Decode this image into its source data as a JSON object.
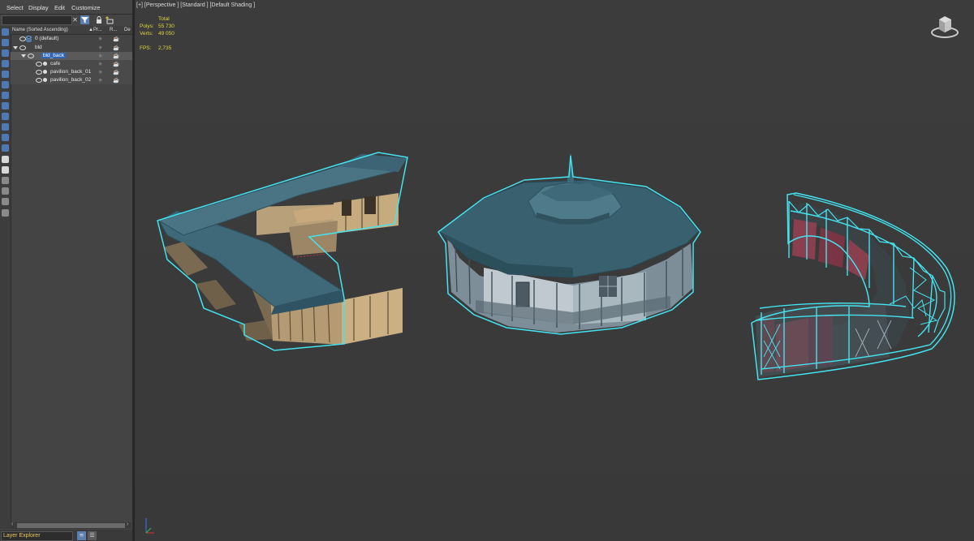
{
  "menu": {
    "select": "Select",
    "display": "Display",
    "edit": "Edit",
    "customize": "Customize"
  },
  "search": {
    "value": "",
    "placeholder": ""
  },
  "icons": {
    "clear": "close-icon",
    "filter": "filter-icon",
    "lock": "lock-icon",
    "new_layer": "add-layer-icon",
    "eye": "eye-icon",
    "freeze": "snowflake-icon",
    "render": "teapot-icon",
    "expand": "triangle-down-icon",
    "object": "object-dot-icon"
  },
  "columns": {
    "name": "Name (Sorted Ascending)",
    "sort_arrow": "▲",
    "primary": "Pr...",
    "render": "R...",
    "display": "De"
  },
  "tree": [
    {
      "label": "0 (default)",
      "type": "layer"
    },
    {
      "label": "bld",
      "type": "layer"
    },
    {
      "label": "bld_back",
      "type": "layer",
      "highlighted": true
    },
    {
      "label": "cafe",
      "type": "object"
    },
    {
      "label": "pavilion_back_01",
      "type": "object"
    },
    {
      "label": "pavilion_back_02",
      "type": "object"
    }
  ],
  "footer": {
    "explorer_label": "Layer Explorer"
  },
  "viewport": {
    "label": "[+] [Perspective ] [Standard ] [Default Shading ]",
    "stats": {
      "header": "Total",
      "polys_label": "Polys:",
      "polys_value": "55 730",
      "verts_label": "Verts:",
      "verts_value": "49 050",
      "fps_label": "FPS:",
      "fps_value": "2,735"
    },
    "objects": [
      "cafe",
      "pavilion_back_01",
      "pavilion_back_02"
    ]
  },
  "colors": {
    "panel_bg": "#444444",
    "viewport_bg": "#3b3b3b",
    "selection_outline": "#44e3f0",
    "stats_text": "#e0d63c",
    "roof": "#3f6878",
    "wood": "#c7a97d",
    "red_panel": "#8a3f4e",
    "accent_blue": "#4f79b3"
  }
}
